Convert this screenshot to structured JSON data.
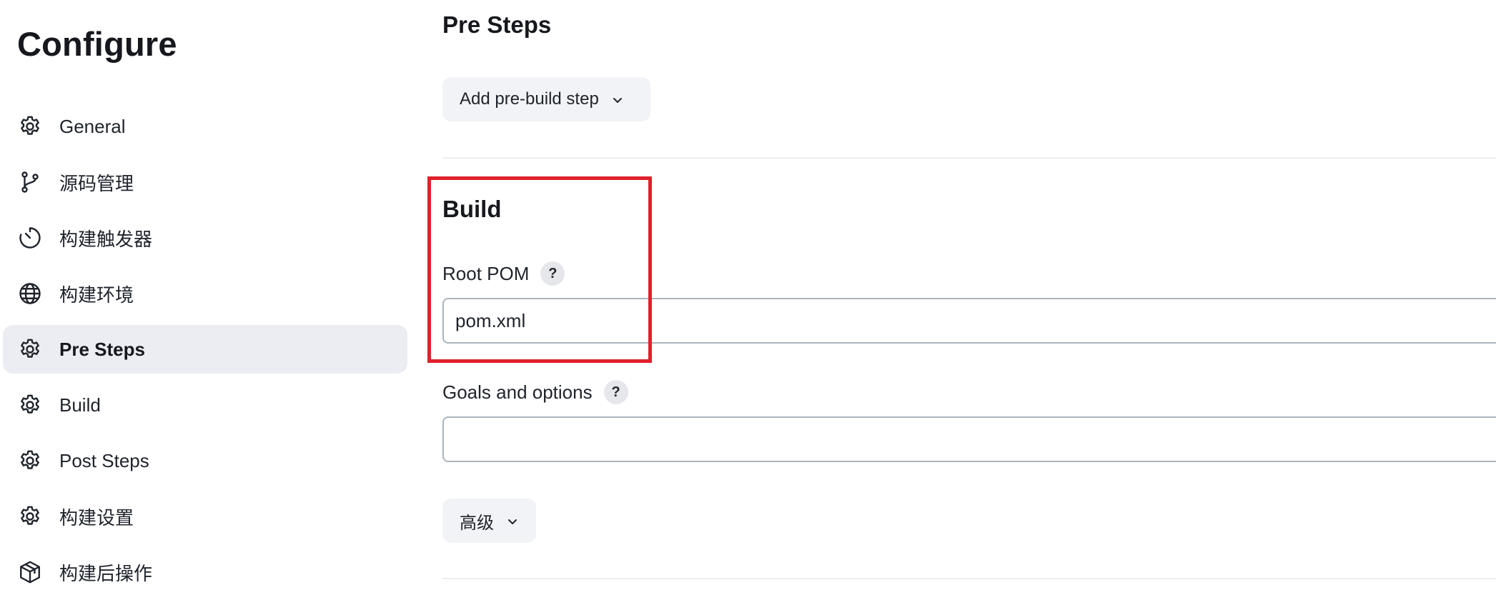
{
  "sidebar": {
    "title": "Configure",
    "items": [
      {
        "label": "General",
        "icon": "gear-icon",
        "active": false
      },
      {
        "label": "源码管理",
        "icon": "branch-icon",
        "active": false
      },
      {
        "label": "构建触发器",
        "icon": "clock-icon",
        "active": false
      },
      {
        "label": "构建环境",
        "icon": "globe-icon",
        "active": false
      },
      {
        "label": "Pre Steps",
        "icon": "gear-icon",
        "active": true
      },
      {
        "label": "Build",
        "icon": "gear-icon",
        "active": false
      },
      {
        "label": "Post Steps",
        "icon": "gear-icon",
        "active": false
      },
      {
        "label": "构建设置",
        "icon": "gear-icon",
        "active": false
      },
      {
        "label": "构建后操作",
        "icon": "package-icon",
        "active": false
      }
    ]
  },
  "pre_steps": {
    "title": "Pre Steps",
    "add_button_label": "Add pre-build step"
  },
  "build": {
    "title": "Build",
    "root_pom_label": "Root POM",
    "root_pom_value": "pom.xml",
    "goals_label": "Goals and options",
    "goals_value": "",
    "help_symbol": "?",
    "advanced_label": "高级"
  },
  "colors": {
    "highlight": "#e0212c",
    "active_nav_bg": "#ecedf2",
    "input_border": "#a8b4bd"
  }
}
